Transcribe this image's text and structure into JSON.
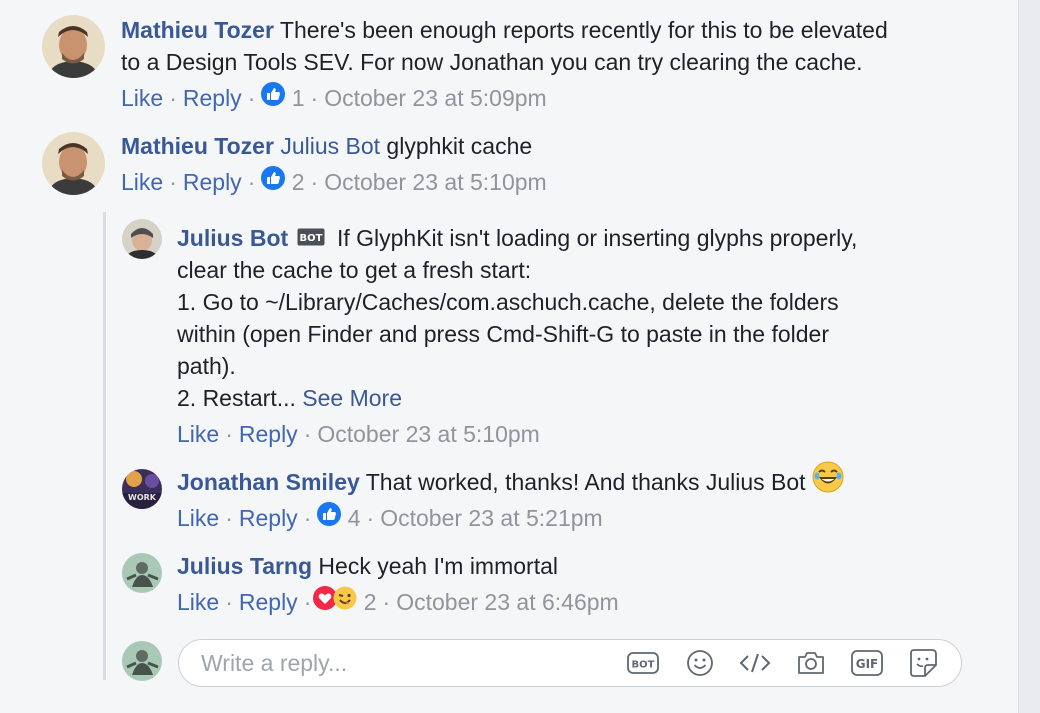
{
  "comments": [
    {
      "author": "Mathieu Tozer",
      "text_l1": " There's been enough reports recently for this to be elevated",
      "text_l2": "to a Design Tools SEV. For now Jonathan you can try clearing the cache.",
      "like": "Like",
      "reply": "Reply",
      "reaction_count": "1",
      "time": "October 23 at 5:09pm"
    },
    {
      "author": "Mathieu Tozer",
      "mention": "Julius Bot",
      "text": " glyphkit cache",
      "like": "Like",
      "reply": "Reply",
      "reaction_count": "2",
      "time": "October 23 at 5:10pm"
    }
  ],
  "replies": [
    {
      "author": "Julius Bot",
      "badge": "BOT",
      "lines": [
        " If GlyphKit isn't loading or inserting glyphs properly,",
        "clear the cache to get a fresh start:",
        "1. Go to ~/Library/Caches/com.aschuch.cache, delete the folders",
        "within (open Finder and press Cmd-Shift-G to paste in the folder",
        "path).",
        "2. Restart... "
      ],
      "see_more": "See More",
      "like": "Like",
      "reply": "Reply",
      "time": "October 23 at 5:10pm"
    },
    {
      "author": "Jonathan Smiley",
      "avatar_label": "WORK",
      "text": " That worked, thanks! And thanks Julius Bot ",
      "like": "Like",
      "reply": "Reply",
      "reaction_count": "4",
      "time": "October 23 at 5:21pm"
    },
    {
      "author": "Julius Tarng",
      "text": " Heck yeah I'm immortal",
      "like": "Like",
      "reply": "Reply",
      "reaction_count": "2",
      "time": "October 23 at 6:46pm"
    }
  ],
  "composer": {
    "placeholder": "Write a reply...",
    "bot_label": "BOT",
    "gif_label": "GIF",
    "tools": [
      "bot-icon",
      "emoji-icon",
      "code-icon",
      "camera-icon",
      "gif-icon",
      "sticker-icon"
    ]
  },
  "colors": {
    "link": "#385898",
    "action": "#4267b2",
    "meta": "#90949c",
    "like_reaction": "#1877f2",
    "love_reaction": "#f0284a"
  }
}
